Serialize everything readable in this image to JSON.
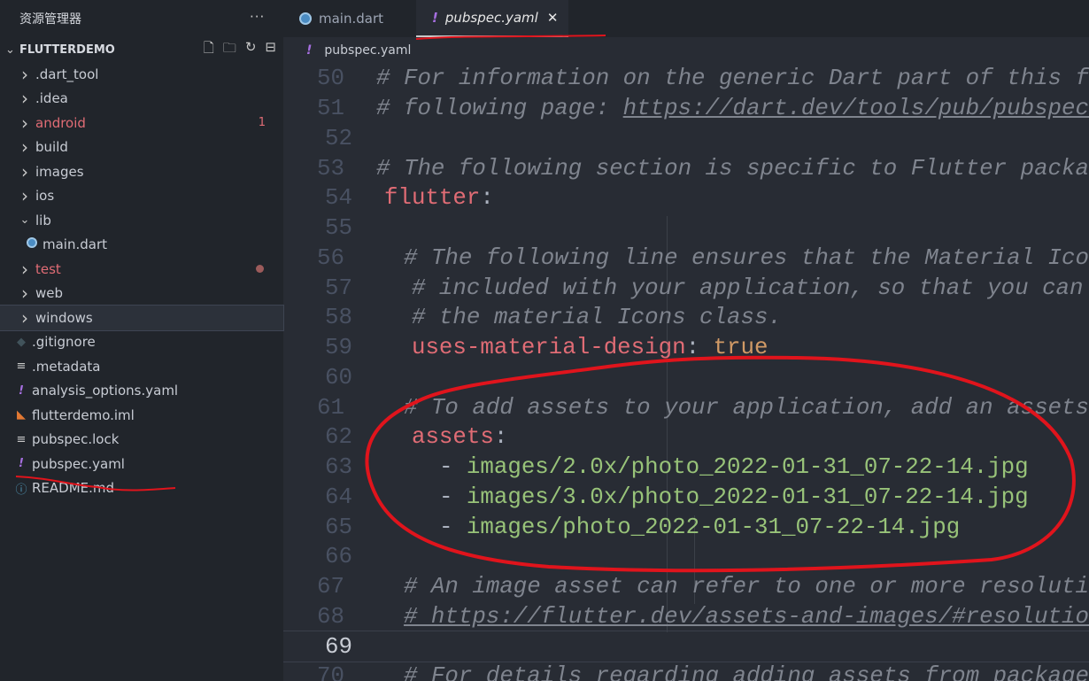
{
  "sidebar": {
    "title": "资源管理器",
    "more": "···",
    "project": "FLUTTERDEMO",
    "items": [
      {
        "label": ".dart_tool",
        "icon": "chevron-right",
        "type": "folder"
      },
      {
        "label": ".idea",
        "icon": "chevron-right",
        "type": "folder"
      },
      {
        "label": "android",
        "icon": "chevron-right",
        "type": "folder",
        "badge": "1",
        "color": "#e06c75"
      },
      {
        "label": "build",
        "icon": "chevron-right",
        "type": "folder"
      },
      {
        "label": "images",
        "icon": "chevron-right",
        "type": "folder"
      },
      {
        "label": "ios",
        "icon": "chevron-right",
        "type": "folder"
      },
      {
        "label": "lib",
        "icon": "chevron-down",
        "type": "folder"
      },
      {
        "label": "main.dart",
        "icon": "dart",
        "type": "file"
      },
      {
        "label": "test",
        "icon": "chevron-right",
        "type": "folder",
        "dot": true,
        "color": "#e06c75"
      },
      {
        "label": "web",
        "icon": "chevron-right",
        "type": "folder"
      },
      {
        "label": "windows",
        "icon": "chevron-right",
        "type": "folder",
        "selected": true
      },
      {
        "label": ".gitignore",
        "icon": "git",
        "type": "file"
      },
      {
        "label": ".metadata",
        "icon": "lines",
        "type": "file"
      },
      {
        "label": "analysis_options.yaml",
        "icon": "yaml",
        "type": "file"
      },
      {
        "label": "flutterdemo.iml",
        "icon": "rss",
        "type": "file"
      },
      {
        "label": "pubspec.lock",
        "icon": "lines",
        "type": "file"
      },
      {
        "label": "pubspec.yaml",
        "icon": "yaml",
        "type": "file"
      },
      {
        "label": "README.md",
        "icon": "info",
        "type": "file"
      }
    ]
  },
  "tabs": [
    {
      "label": "main.dart",
      "active": false
    },
    {
      "label": "pubspec.yaml",
      "active": true,
      "close": "✕"
    }
  ],
  "breadcrumb": "pubspec.yaml",
  "editor": {
    "current_line": 69,
    "lines": [
      {
        "n": 50,
        "parts": [
          [
            "cm",
            "# For information on the generic Dart part of this f"
          ]
        ]
      },
      {
        "n": 51,
        "parts": [
          [
            "cm",
            "# following page: "
          ],
          [
            "cm url",
            "https://dart.dev/tools/pub/pubspec"
          ]
        ]
      },
      {
        "n": 52,
        "parts": []
      },
      {
        "n": 53,
        "parts": [
          [
            "cm",
            "# The following section is specific to Flutter packa"
          ]
        ]
      },
      {
        "n": 54,
        "parts": [
          [
            "key",
            "flutter"
          ],
          [
            "punc",
            ":"
          ]
        ]
      },
      {
        "n": 55,
        "parts": []
      },
      {
        "n": 56,
        "parts": [
          [
            "",
            "  "
          ],
          [
            "cm",
            "# The following line ensures that the Material Ico"
          ]
        ]
      },
      {
        "n": 57,
        "parts": [
          [
            "",
            "  "
          ],
          [
            "cm",
            "# included with your application, so that you can"
          ]
        ]
      },
      {
        "n": 58,
        "parts": [
          [
            "",
            "  "
          ],
          [
            "cm",
            "# the material Icons class."
          ]
        ]
      },
      {
        "n": 59,
        "parts": [
          [
            "",
            "  "
          ],
          [
            "key",
            "uses-material-design"
          ],
          [
            "punc",
            ": "
          ],
          [
            "bool",
            "true"
          ]
        ]
      },
      {
        "n": 60,
        "parts": []
      },
      {
        "n": 61,
        "parts": [
          [
            "",
            "  "
          ],
          [
            "cm",
            "# To add assets to your application, add an assets"
          ]
        ]
      },
      {
        "n": 62,
        "parts": [
          [
            "",
            "  "
          ],
          [
            "key",
            "assets"
          ],
          [
            "punc",
            ":"
          ]
        ]
      },
      {
        "n": 63,
        "parts": [
          [
            "",
            "    "
          ],
          [
            "punc",
            "- "
          ],
          [
            "str",
            "images/2.0x/photo_2022-01-31_07-22-14.jpg"
          ]
        ]
      },
      {
        "n": 64,
        "parts": [
          [
            "",
            "    "
          ],
          [
            "punc",
            "- "
          ],
          [
            "str",
            "images/3.0x/photo_2022-01-31_07-22-14.jpg"
          ]
        ]
      },
      {
        "n": 65,
        "parts": [
          [
            "",
            "    "
          ],
          [
            "punc",
            "- "
          ],
          [
            "str",
            "images/photo_2022-01-31_07-22-14.jpg"
          ]
        ]
      },
      {
        "n": 66,
        "parts": []
      },
      {
        "n": 67,
        "parts": [
          [
            "",
            "  "
          ],
          [
            "cm",
            "# An image asset can refer to one or more resoluti"
          ]
        ]
      },
      {
        "n": 68,
        "parts": [
          [
            "",
            "  "
          ],
          [
            "cm url",
            "# https://flutter.dev/assets-and-images/#resolutio"
          ]
        ]
      },
      {
        "n": 69,
        "parts": []
      },
      {
        "n": 70,
        "parts": [
          [
            "",
            "  "
          ],
          [
            "cm",
            "# For details regarding adding assets from package"
          ]
        ]
      }
    ]
  }
}
